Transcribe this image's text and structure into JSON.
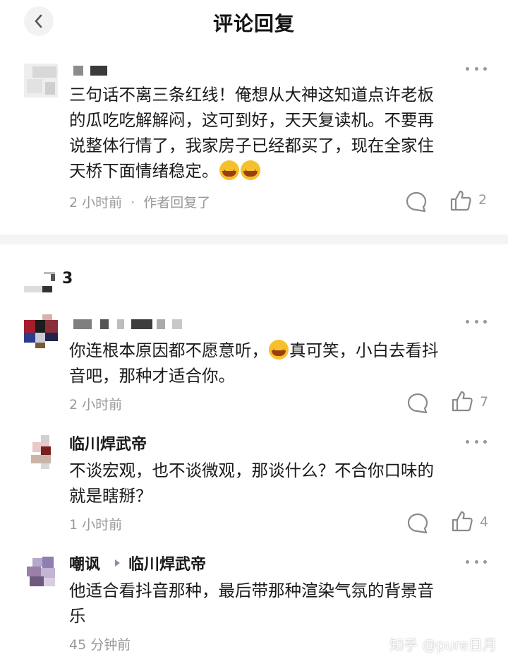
{
  "header": {
    "title": "评论回复",
    "back_icon": "chevron-left-icon"
  },
  "root_comment": {
    "text_lines": [
      "三句话不离三条红线！俺想从大神这知道点许老板",
      "的瓜吃吃解解闷，这可到好，天天复读机。不要再",
      "说整体行情了，我家房子已经都买了，现在全家住"
    ],
    "text_last": "天桥下面情绪稳定。",
    "time": "2 小时前",
    "separator": "·",
    "author_replied": "作者回复了",
    "likes": "2"
  },
  "thread": {
    "count": "3"
  },
  "replies": [
    {
      "text_line1_a": "你连根本原因都不愿意听，",
      "text_line1_b": "真可笑，小白去看抖",
      "text_line2": "音吧，那种才适合你。",
      "time": "2 小时前",
      "likes": "7"
    },
    {
      "username": "临川焊武帝",
      "text_lines": [
        "不谈宏观，也不谈微观，那谈什么？不合你口味的",
        "就是瞎掰？"
      ],
      "time": "1 小时前",
      "likes": "4"
    },
    {
      "username": "嘲讽",
      "reply_to": "临川焊武帝",
      "text_lines": [
        "他适合看抖音那种，最后带那种渲染气氛的背景音",
        "乐"
      ],
      "time": "45 分钟前"
    }
  ],
  "watermark": "知乎 @pure日月",
  "colors": {
    "text_primary": "#1a1a1a",
    "text_secondary": "#999999",
    "divider": "#f4f4f4",
    "icon": "#8a8a8a"
  }
}
